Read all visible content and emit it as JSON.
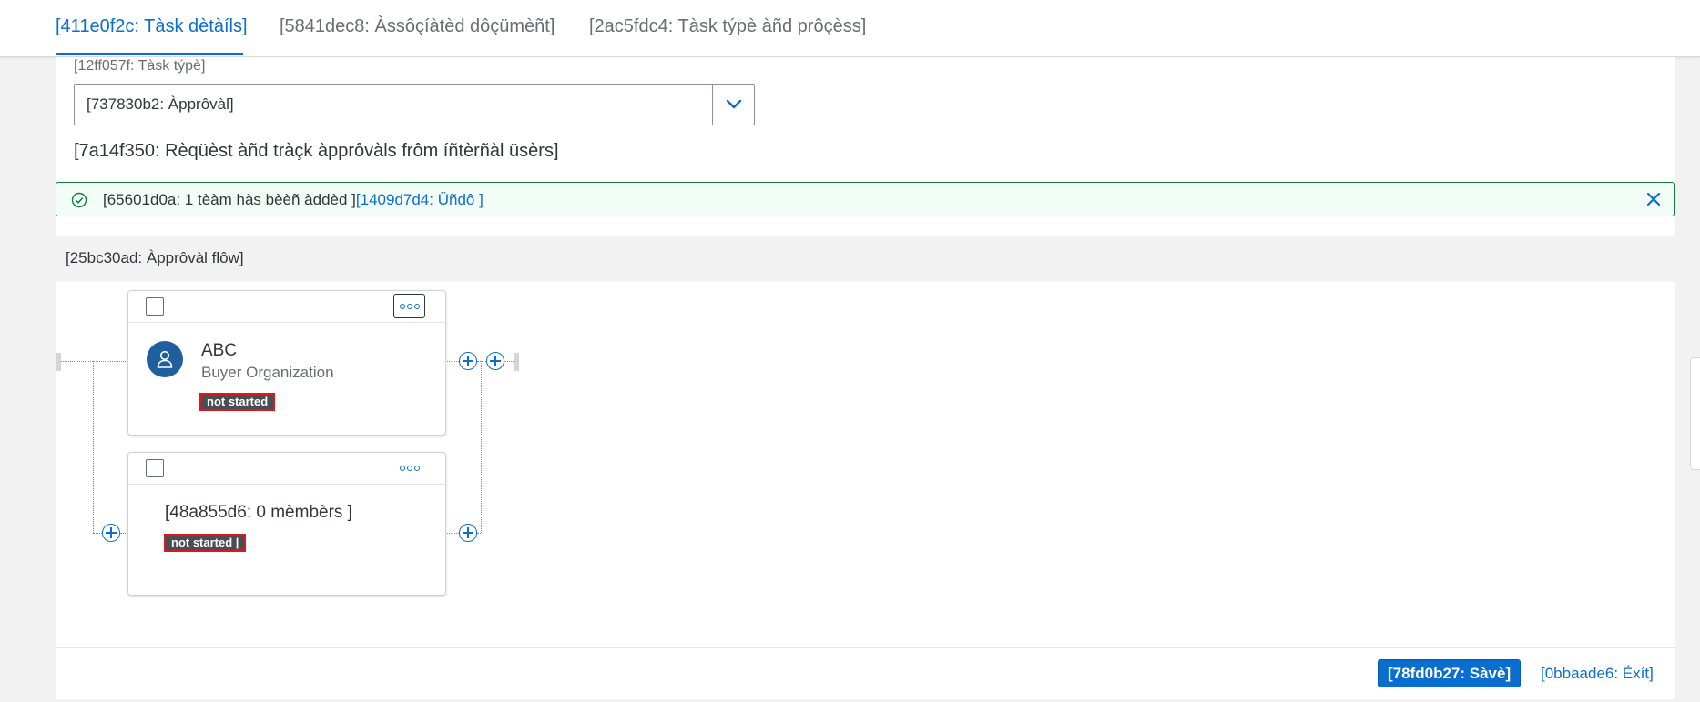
{
  "tabs": [
    {
      "label": "[411e0f2c: Tàsk dètàíls]",
      "active": true
    },
    {
      "label": "[5841dec8: Àssôçíàtèd dôçümèñt]",
      "active": false
    },
    {
      "label": "[2ac5fdc4: Tàsk týpè àñd prôçèss]",
      "active": false
    }
  ],
  "task_type": {
    "label": "[12ff057f: Tàsk týpè]",
    "value": "[737830b2: Àpprôvàl]",
    "dropdown_icon": "chevron-down-icon"
  },
  "description": "[7a14f350: Rèqüèst àñd tràçk àpprôvàls frôm íñtèrñàl üsèrs]",
  "message_strip": {
    "text": "[65601d0a: 1 tèàm hàs bèèñ àddèd ]",
    "link": "[1409d7d4: Üñdô ]",
    "status_color": "#107e3e",
    "icon": "success-check-icon",
    "close_icon": "close-icon"
  },
  "approval_flow": {
    "title": "[25bc30ad: Àpprôvàl flôw]",
    "cards": [
      {
        "name": "ABC",
        "subtitle": "Buyer Organization",
        "status": "not started",
        "avatar_icon": "person-icon"
      },
      {
        "name": "[48a855d6: 0 mèmbèrs ]",
        "status": "not started |"
      }
    ]
  },
  "footer": {
    "save": "[78fd0b27: Sàvè]",
    "exit": "[0bbaade6: Éxít]"
  },
  "colors": {
    "accent": "#0a6ed1",
    "badge_border": "#e0161c",
    "avatar": "#1f5f9e"
  }
}
